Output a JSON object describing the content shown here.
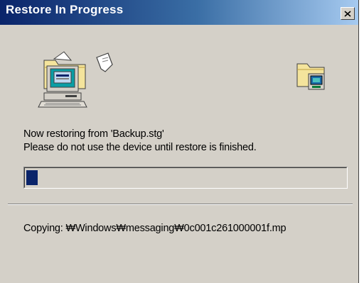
{
  "window": {
    "title": "Restore In Progress",
    "close_label": "Close"
  },
  "icons": {
    "left": "computer-with-flying-document-icon",
    "right": "folder-with-device-icon"
  },
  "message": {
    "line1": "Now restoring from 'Backup.stg'",
    "line2": "Please do not use the device until restore is finished."
  },
  "progress": {
    "fraction": 0.035
  },
  "status": {
    "text": "Copying:  ₩Windows₩messaging₩0c001c261000001f.mp"
  },
  "colors": {
    "accent": "#0a246a",
    "face": "#d4d0c8"
  }
}
